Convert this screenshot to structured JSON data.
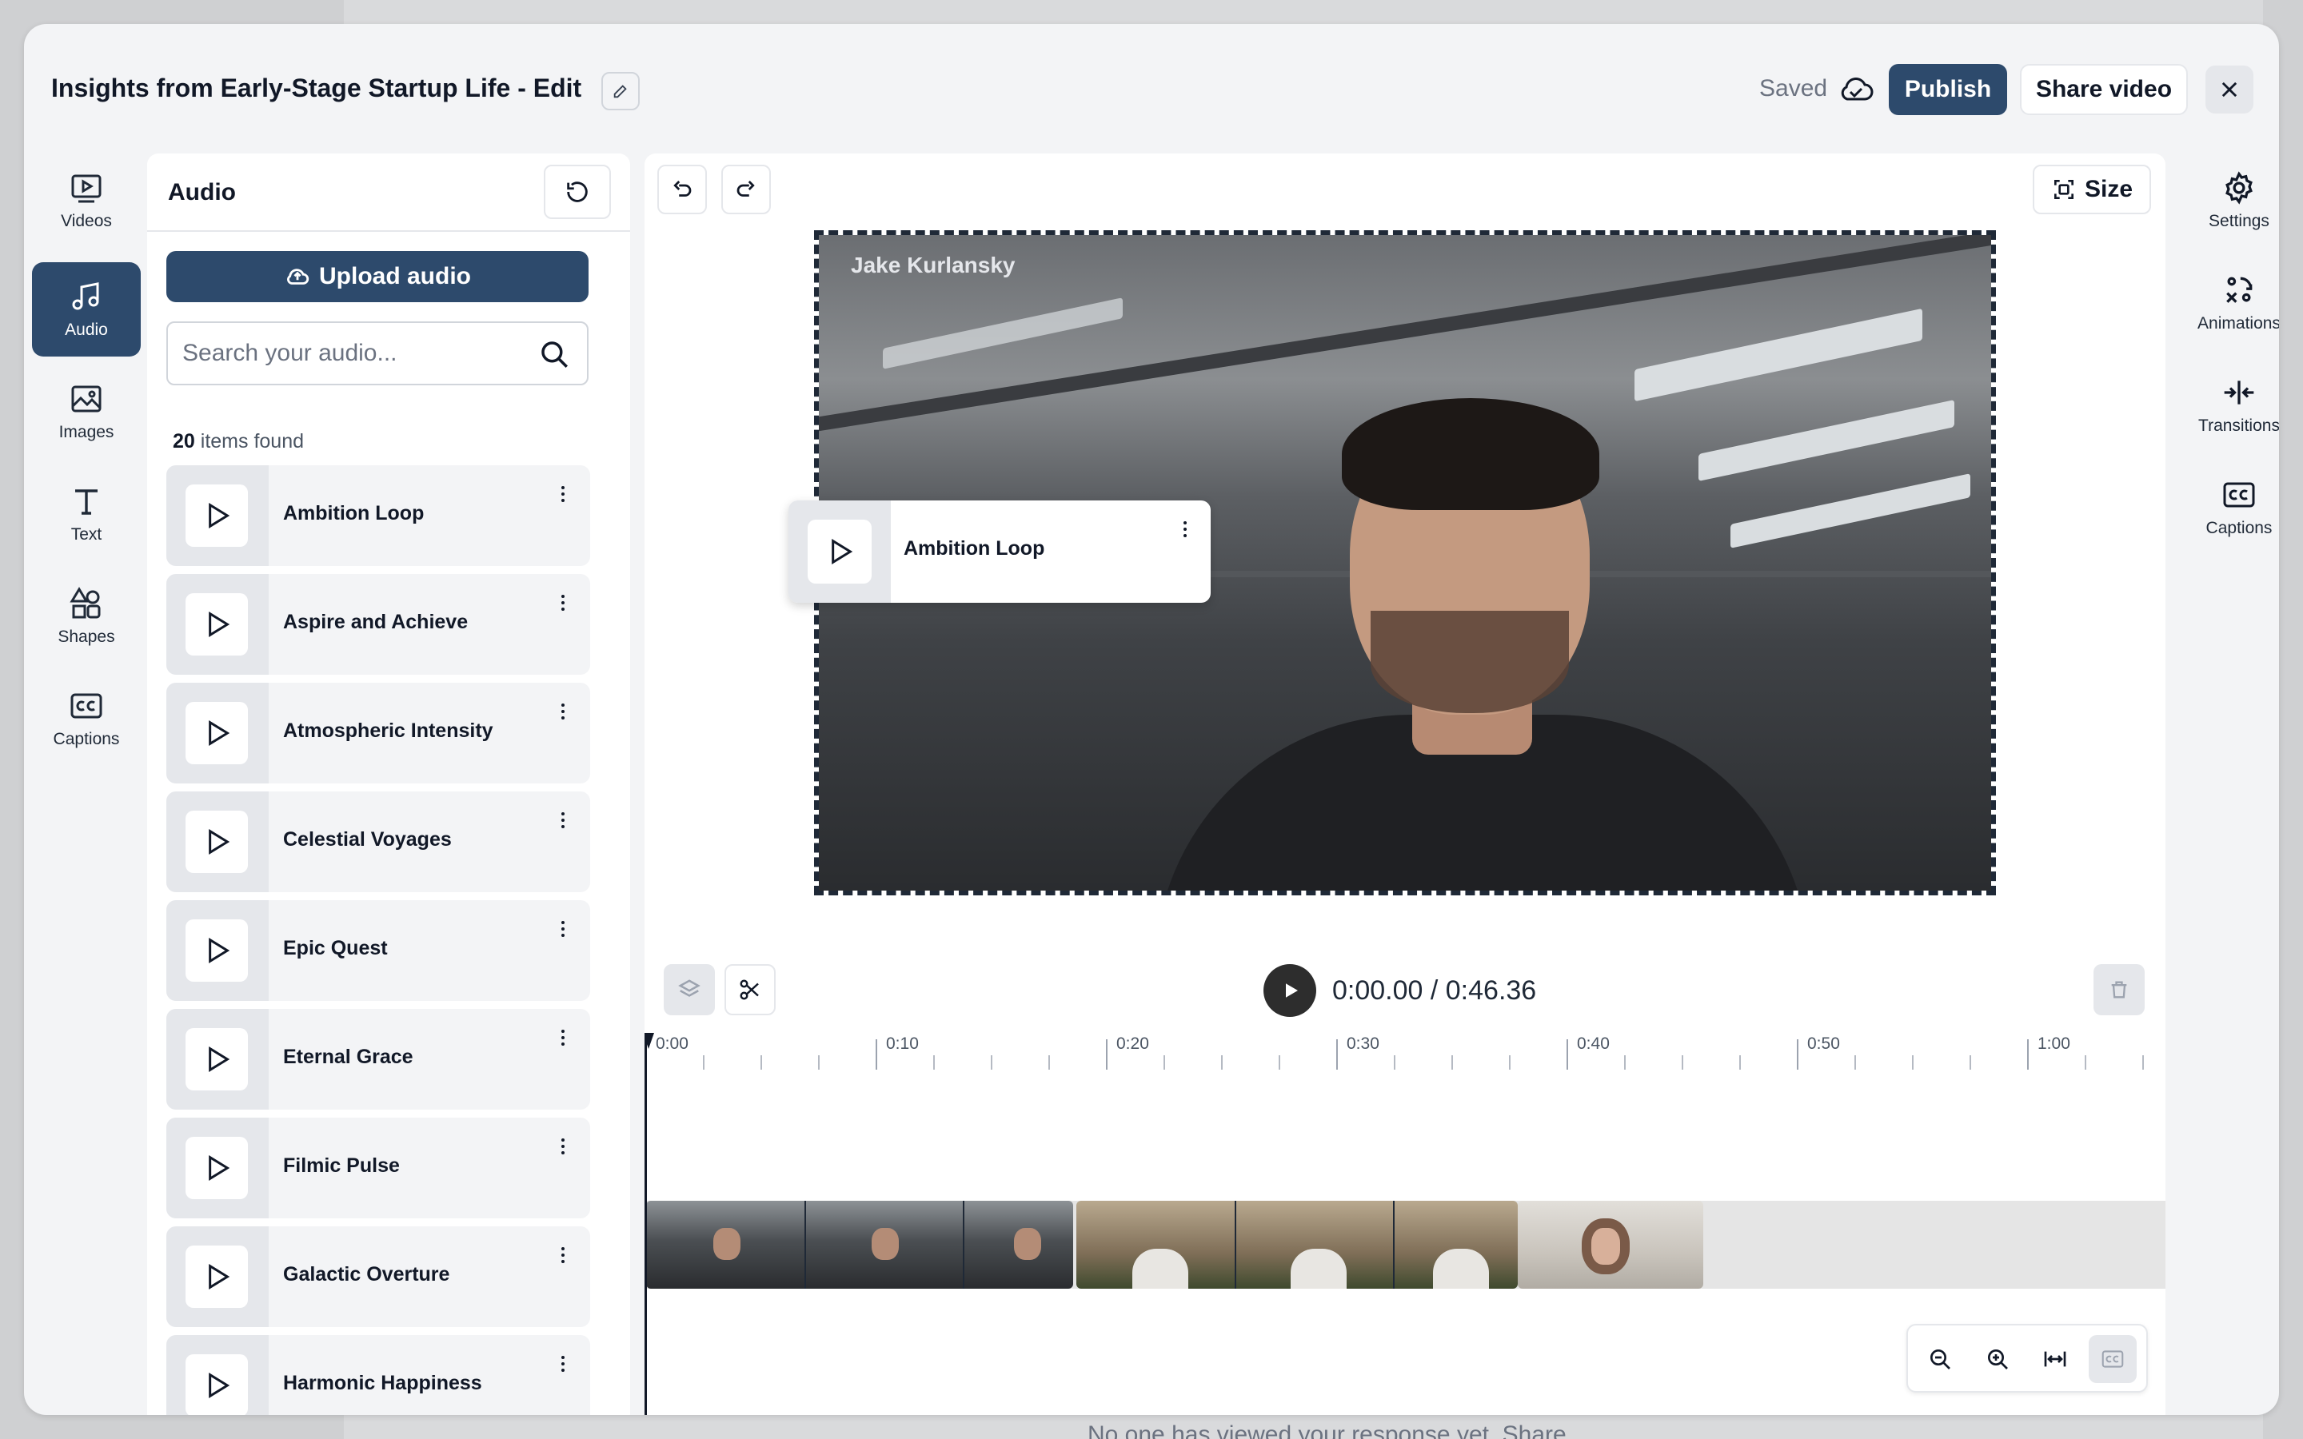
{
  "editor": {
    "title": "Insights from Early-Stage Startup Life - Edit",
    "saved_label": "Saved",
    "publish_label": "Publish",
    "share_label": "Share video"
  },
  "left_rail": {
    "items": [
      {
        "label": "Videos",
        "icon": "video-play-icon"
      },
      {
        "label": "Audio",
        "icon": "music-note-icon",
        "active": true
      },
      {
        "label": "Images",
        "icon": "image-icon"
      },
      {
        "label": "Text",
        "icon": "text-t-icon"
      },
      {
        "label": "Shapes",
        "icon": "shapes-icon"
      },
      {
        "label": "Captions",
        "icon": "cc-icon"
      }
    ]
  },
  "audio_panel": {
    "title": "Audio",
    "upload_label": "Upload audio",
    "search_placeholder": "Search your audio...",
    "count_number": "20",
    "count_suffix": "items found",
    "tracks": [
      "Ambition Loop",
      "Aspire and Achieve",
      "Atmospheric Intensity",
      "Celestial Voyages",
      "Epic Quest",
      "Eternal Grace",
      "Filmic Pulse",
      "Galactic Overture",
      "Harmonic Happiness"
    ]
  },
  "preview": {
    "size_label": "Size",
    "speaker_label": "Jake Kurlansky",
    "floating_track": "Ambition Loop"
  },
  "right_rail": {
    "items": [
      {
        "label": "Settings",
        "icon": "gear-icon"
      },
      {
        "label": "Animations",
        "icon": "animation-icon"
      },
      {
        "label": "Transitions",
        "icon": "transition-icon"
      },
      {
        "label": "Captions",
        "icon": "cc-icon"
      }
    ]
  },
  "timeline": {
    "time_display": "0:00.00 / 0:46.36",
    "ticks": [
      "0:00",
      "0:10",
      "0:20",
      "0:30",
      "0:40",
      "0:50",
      "1:00"
    ]
  },
  "backdrop": {
    "footer_text": "No one has viewed your response yet. Share"
  },
  "colors": {
    "primary": "#2d4a6c",
    "panel_bg": "#ffffff",
    "modal_bg": "#f3f4f6"
  }
}
